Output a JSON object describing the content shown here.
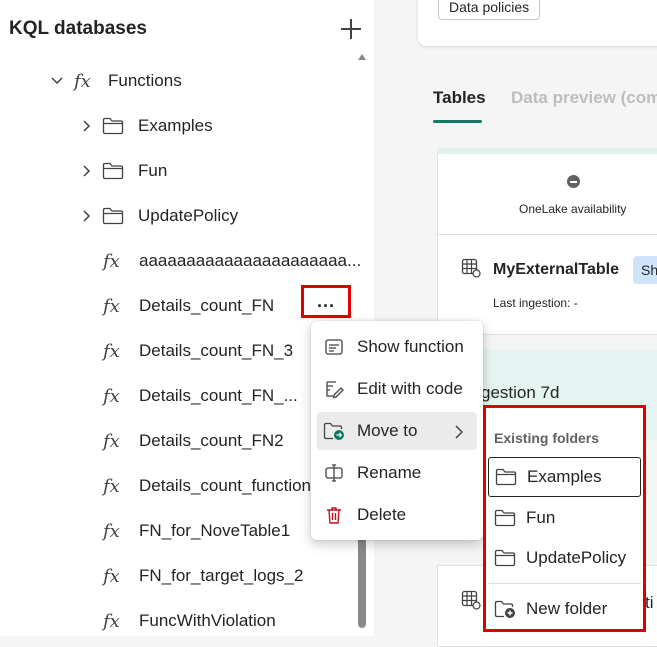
{
  "left_panel": {
    "title": "KQL databases",
    "tree": {
      "functions_node": "Functions",
      "folders": [
        "Examples",
        "Fun",
        "UpdatePolicy"
      ],
      "functions": [
        "aaaaaaaaaaaaaaaaaaaaaa...",
        "Details_count_FN",
        "Details_count_FN_3",
        "Details_count_FN_...",
        "Details_count_FN2",
        "Details_count_function",
        "FN_for_NoveTable1",
        "FN_for_target_logs_2",
        "FuncWithViolation"
      ]
    },
    "more_button": "..."
  },
  "context_menu": {
    "items": [
      "Show function",
      "Edit with code",
      "Move to",
      "Rename",
      "Delete"
    ],
    "active_item": "Move to"
  },
  "submenu": {
    "header": "Existing folders",
    "folders": [
      "Examples",
      "Fun",
      "UpdatePolicy"
    ],
    "new_folder": "New folder"
  },
  "right_panel": {
    "data_policies_button": "Data policies",
    "tabs": [
      "Tables",
      "Data preview (com"
    ],
    "active_tab": "Tables",
    "onelake_label": "OneLake availability",
    "table_name": "MyExternalTable",
    "table_badge": "Sh",
    "last_ingestion": "Last ingestion: -",
    "ingestion_label": "gestion 7d",
    "bottom_partial": "ti"
  },
  "colors": {
    "accent": "#117865",
    "highlight_border": "#e00000",
    "badge_bg": "#cfe4fa",
    "ingestion_bg": "#e6f4f1"
  },
  "icons": {
    "add": "plus-icon",
    "function": "fx-icon",
    "folder": "folder-icon",
    "show": "show-function-icon",
    "edit": "edit-code-icon",
    "move": "move-to-folder-icon",
    "rename": "rename-icon",
    "delete": "trash-icon",
    "new_folder": "new-folder-icon"
  }
}
